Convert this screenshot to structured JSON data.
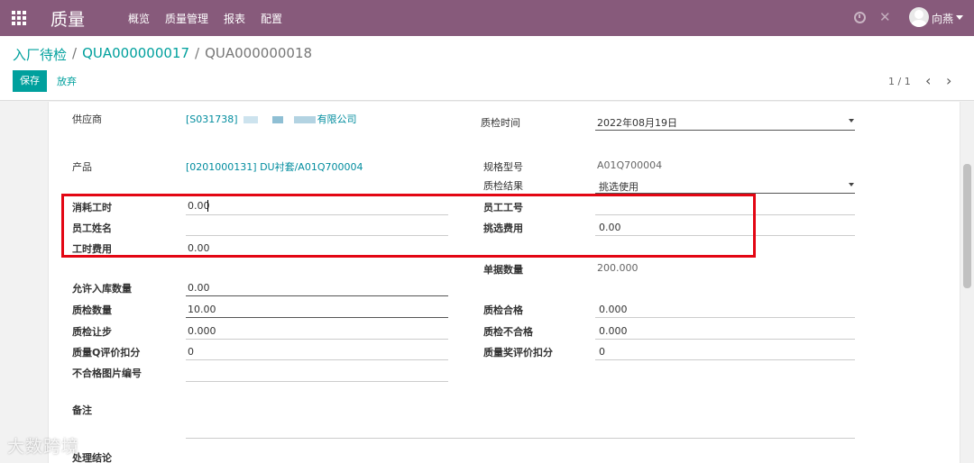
{
  "app": {
    "title": "质量"
  },
  "menu": [
    "概览",
    "质量管理",
    "报表",
    "配置"
  ],
  "user": {
    "name": "向燕"
  },
  "breadcrumb": {
    "root": "入厂待检",
    "sep": "/",
    "parent": "QUA000000017",
    "current": "QUA000000018"
  },
  "buttons": {
    "save": "保存",
    "discard": "放弃"
  },
  "pager": {
    "value": "1 / 1"
  },
  "form": {
    "supplier_label": "供应商",
    "supplier_value_code": "[S031738]",
    "supplier_value_suffix": "有限公司",
    "check_time_label": "质检时间",
    "check_time_value": "2022年08月19日",
    "product_label": "产品",
    "product_value": "[0201000131] DU衬套/A01Q700004",
    "spec_label": "规格型号",
    "spec_value": "A01Q700004",
    "result_label": "质检结果",
    "result_value": "挑选使用",
    "labor_hours_label": "消耗工时",
    "labor_hours_value": "0.00",
    "employee_no_label": "员工工号",
    "employee_no_value": "",
    "employee_name_label": "员工姓名",
    "employee_name_value": "",
    "pick_fee_label": "挑选费用",
    "pick_fee_value": "0.00",
    "labor_fee_label": "工时费用",
    "labor_fee_value": "0.00",
    "doc_qty_label": "单据数量",
    "doc_qty_value": "200.000",
    "allowed_in_label": "允许入库数量",
    "allowed_in_value": "0.00",
    "check_qty_label": "质检数量",
    "check_qty_value": "10.00",
    "pass_label": "质检合格",
    "pass_value": "0.000",
    "concession_label": "质检让步",
    "concession_value": "0.000",
    "fail_label": "质检不合格",
    "fail_value": "0.000",
    "q_deduct_label": "质量Q评价扣分",
    "q_deduct_value": "0",
    "reward_deduct_label": "质量奖评价扣分",
    "reward_deduct_value": "0",
    "defect_img_label": "不合格图片编号",
    "defect_img_value": "",
    "note_label": "备注",
    "handling_label": "处理结论"
  },
  "watermark": "大数跨境",
  "colors": {
    "navbar": "#875a7b",
    "accent": "#00a09d",
    "highlight": "#e30613"
  },
  "icons": {
    "apps": "apps-grid-icon",
    "clock": "clock-icon",
    "debug": "debug-icon",
    "prev": "chevron-left-icon",
    "next": "chevron-right-icon"
  }
}
